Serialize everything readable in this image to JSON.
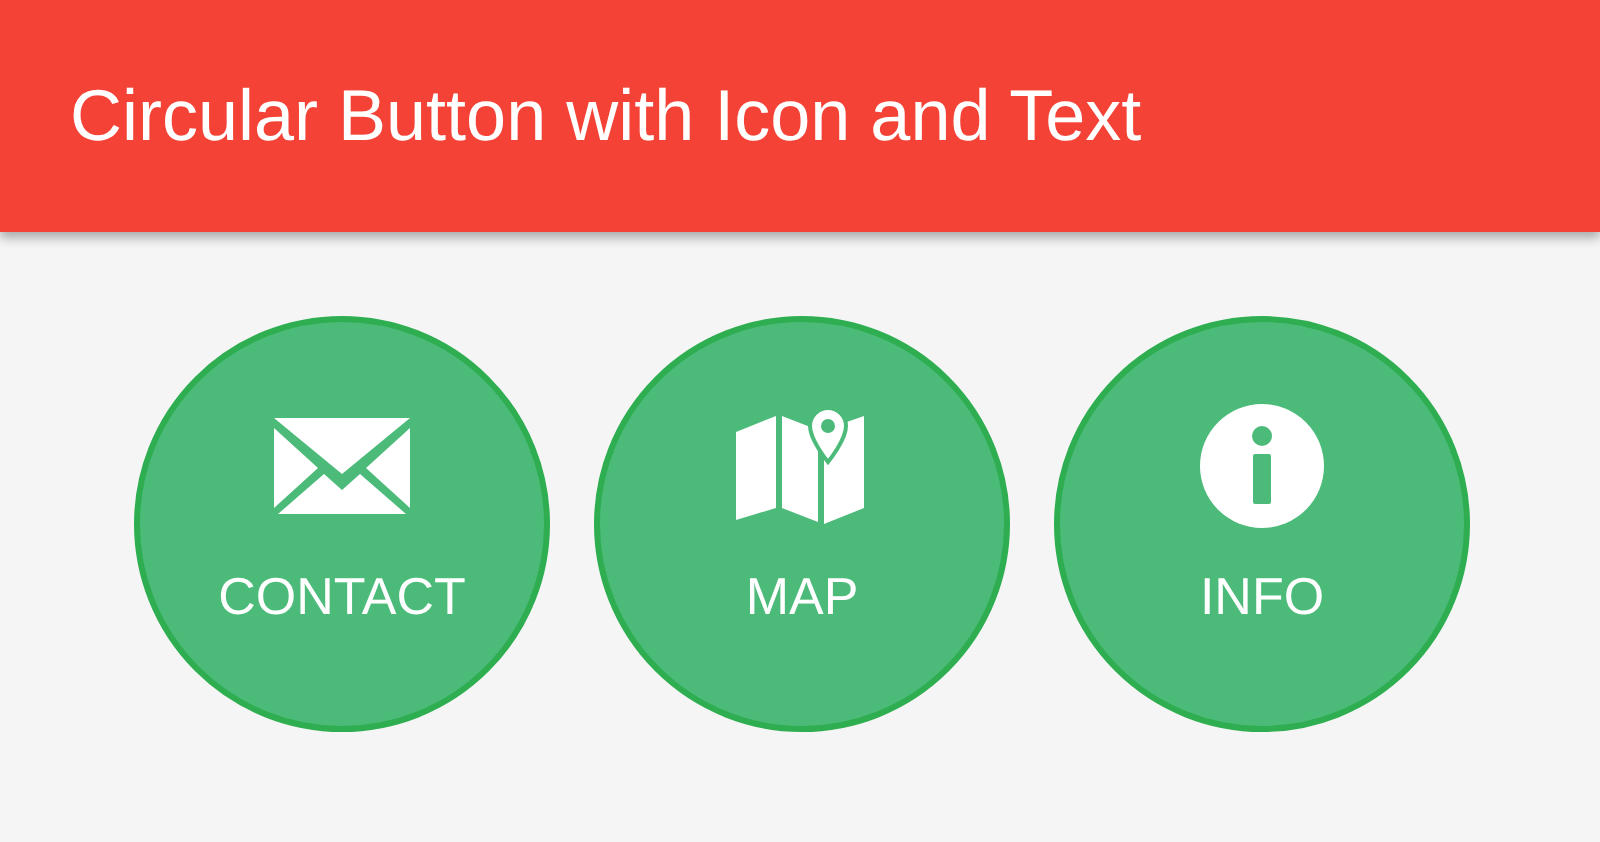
{
  "app_bar": {
    "title": "Circular Button with Icon and Text"
  },
  "buttons": [
    {
      "kind": "mail",
      "label": "CONTACT"
    },
    {
      "kind": "map",
      "label": "MAP"
    },
    {
      "kind": "info",
      "label": "INFO"
    }
  ]
}
